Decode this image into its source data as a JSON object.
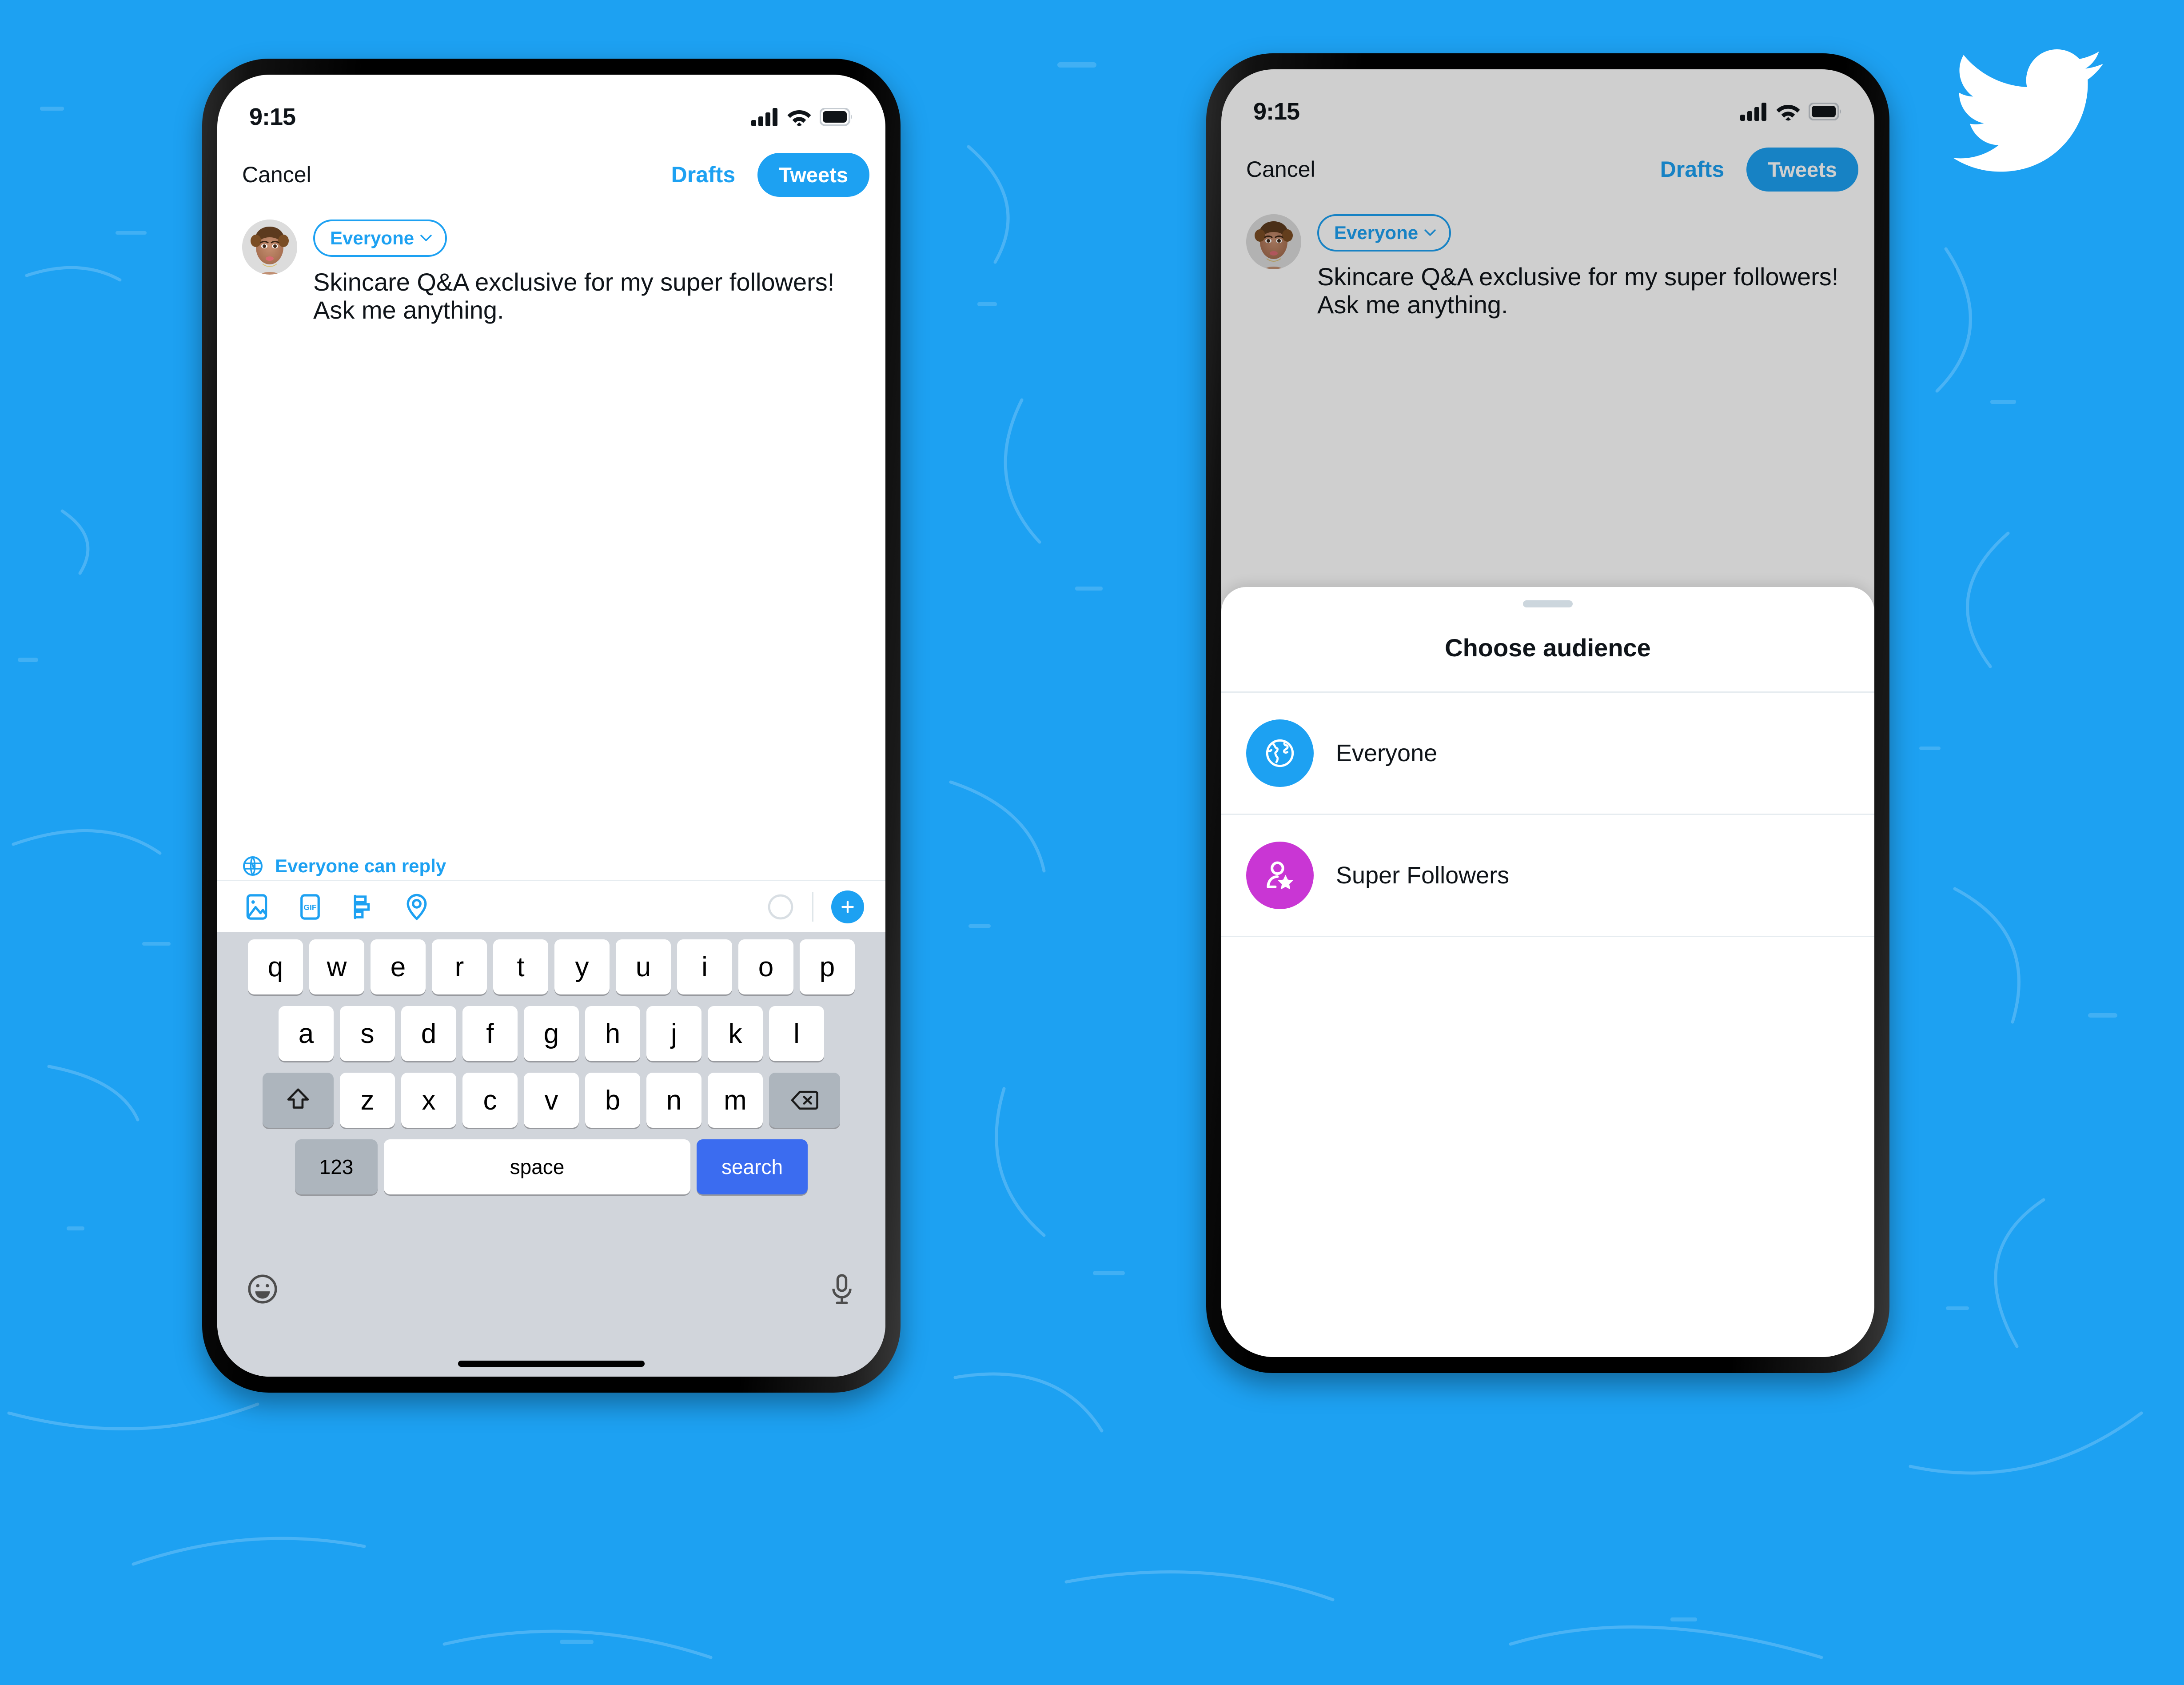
{
  "brand": {
    "background_color": "#1DA1F2",
    "accent_color": "#1DA1F2",
    "logo_name": "twitter-bird-logo",
    "super_followers_color": "#C936D4"
  },
  "phone_left": {
    "status_bar": {
      "time": "9:15",
      "icons": [
        "cellular-signal-icon",
        "wifi-icon",
        "battery-icon"
      ]
    },
    "nav": {
      "cancel_label": "Cancel",
      "drafts_label": "Drafts",
      "tweets_label": "Tweets"
    },
    "compose": {
      "avatar_name": "user-avatar",
      "audience_label": "Everyone",
      "tweet_text": "Skincare Q&A exclusive for my super followers!\nAsk me anything."
    },
    "reply_setting": {
      "icon": "globe-icon",
      "label": "Everyone can reply"
    },
    "toolbar": {
      "icons": [
        "image-icon",
        "gif-icon",
        "poll-icon",
        "location-icon"
      ],
      "gif_label": "GIF",
      "char_counter_name": "character-count-ring",
      "add_label": "+"
    },
    "keyboard": {
      "row1": [
        "q",
        "w",
        "e",
        "r",
        "t",
        "y",
        "u",
        "i",
        "o",
        "p"
      ],
      "row2": [
        "a",
        "s",
        "d",
        "f",
        "g",
        "h",
        "j",
        "k",
        "l"
      ],
      "row3": [
        "z",
        "x",
        "c",
        "v",
        "b",
        "n",
        "m"
      ],
      "shift_label": "shift-key-icon",
      "backspace_label": "backspace-key-icon",
      "numbers_label": "123",
      "space_label": "space",
      "return_label": "search",
      "emoji_label": "emoji-key-icon",
      "dictation_label": "microphone-key-icon"
    }
  },
  "phone_right": {
    "status_bar": {
      "time": "9:15",
      "icons": [
        "cellular-signal-icon",
        "wifi-icon",
        "battery-icon"
      ]
    },
    "nav": {
      "cancel_label": "Cancel",
      "drafts_label": "Drafts",
      "tweets_label": "Tweets"
    },
    "compose": {
      "avatar_name": "user-avatar",
      "audience_label": "Everyone",
      "tweet_text": "Skincare Q&A exclusive for my super followers!\nAsk me anything."
    },
    "sheet": {
      "title": "Choose audience",
      "options": [
        {
          "label": "Everyone",
          "icon": "globe-icon",
          "color": "#1DA1F2"
        },
        {
          "label": "Super Followers",
          "icon": "person-star-icon",
          "color": "#C936D4"
        }
      ]
    }
  }
}
